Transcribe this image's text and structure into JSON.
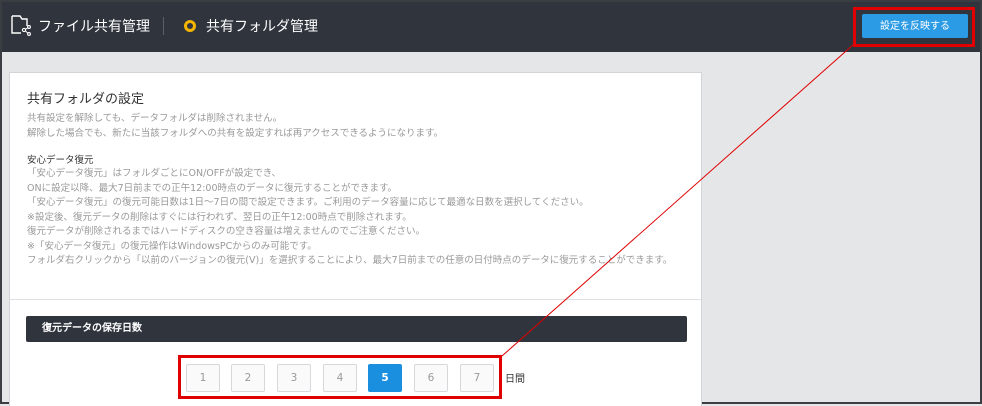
{
  "header": {
    "app_title": "ファイル共有管理",
    "page_title": "共有フォルダ管理",
    "apply_button": "設定を反映する"
  },
  "panel": {
    "title": "共有フォルダの設定",
    "desc_lines": [
      "共有設定を解除しても、データフォルダは削除されません。",
      "解除した場合でも、新たに当該フォルダへの共有を設定すれば再アクセスできるようになります。"
    ],
    "safe_restore_title": "安心データ復元",
    "safe_restore_lines": [
      "「安心データ復元」はフォルダごとにON/OFFが設定でき、",
      "ONに設定以降、最大7日前までの正午12:00時点のデータに復元することができます。",
      "「安心データ復元」の復元可能日数は1日〜7日の間で設定できます。ご利用のデータ容量に応じて最適な日数を選択してください。",
      "※設定後、復元データの削除はすぐには行われず、翌日の正午12:00時点で削除されます。",
      "復元データが削除されるまではハードディスクの空き容量は増えませんのでご注意ください。",
      "※「安心データ復元」の復元操作はWindowsPCからのみ可能です。",
      "フォルダ右クリックから「以前のバージョンの復元(V)」を選択することにより、最大7日前までの任意の日付時点のデータに復元することができます。"
    ],
    "days_section_title": "復元データの保存日数",
    "day_options": [
      "1",
      "2",
      "3",
      "4",
      "5",
      "6",
      "7"
    ],
    "selected_day": "5",
    "days_unit": "日間"
  },
  "colors": {
    "topbar": "#2f343d",
    "accent": "#1a8fe0",
    "highlight": "#e00000",
    "status_dot": "#f5b400"
  },
  "icons": {
    "app": "shared-folder-icon",
    "page": "status-circle-icon"
  }
}
